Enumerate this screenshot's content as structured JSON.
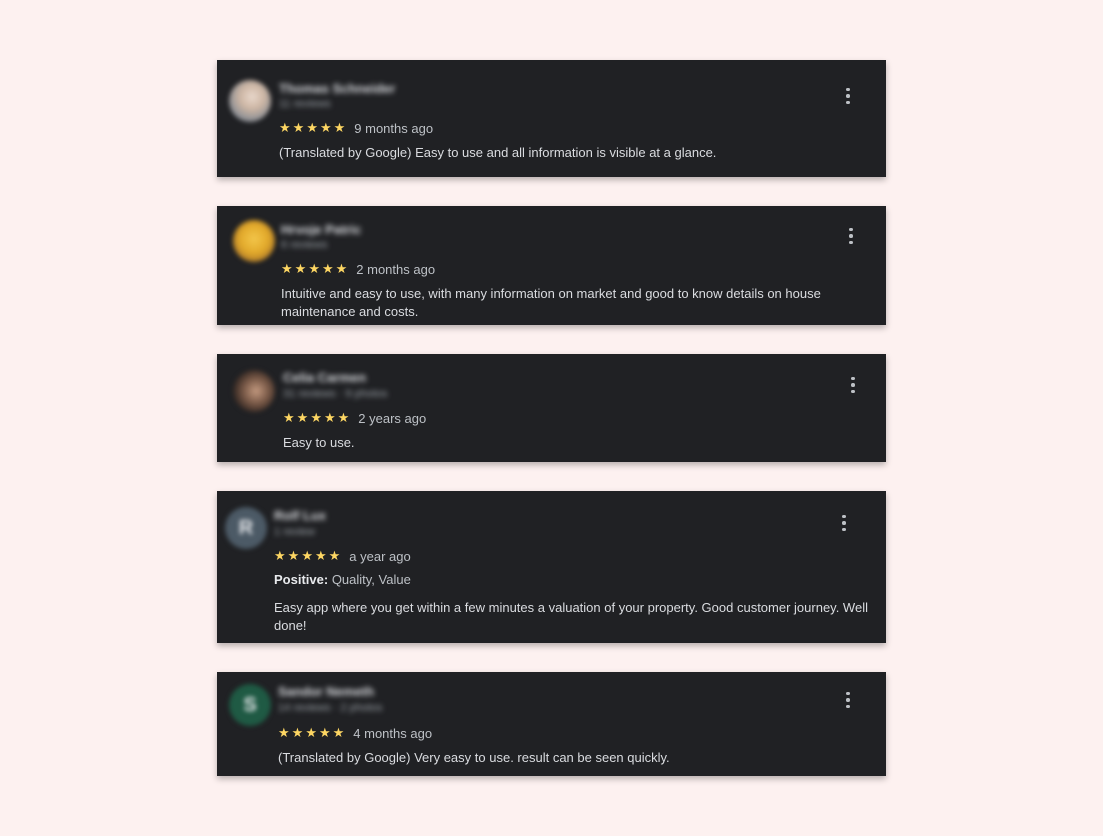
{
  "reviews": [
    {
      "reviewer_name": "Thomas Schneider",
      "reviewer_meta": "11 reviews",
      "stars": "★★★★★",
      "rating": 5,
      "date": "9 months ago",
      "text": "(Translated by Google) Easy to use and all information is visible at a glance."
    },
    {
      "reviewer_name": "Hrvoje Patric",
      "reviewer_meta": "6 reviews",
      "stars": "★★★★★",
      "rating": 5,
      "date": "2 months ago",
      "text": "Intuitive and easy to use, with many information on market and good to know details on house maintenance and costs."
    },
    {
      "reviewer_name": "Celia Carmen",
      "reviewer_meta": "31 reviews · 9 photos",
      "stars": "★★★★★",
      "rating": 5,
      "date": "2 years ago",
      "text": "Easy to use."
    },
    {
      "reviewer_name": "Rolf Lux",
      "reviewer_meta": "1 review",
      "avatar_initial": "R",
      "stars": "★★★★★",
      "rating": 5,
      "date": "a year ago",
      "attributes_label": "Positive:",
      "attributes_value": "Quality, Value",
      "text": "Easy app where you get within a few minutes a valuation of your property. Good customer journey. Well done!"
    },
    {
      "reviewer_name": "Sandor Nemeth",
      "reviewer_meta": "14 reviews · 2 photos",
      "avatar_initial": "S",
      "stars": "★★★★★",
      "rating": 5,
      "date": "4 months ago",
      "text": "(Translated by Google) Very easy to use. result can be seen quickly."
    }
  ],
  "colors": {
    "page_background": "#fdf1f0",
    "card_background": "#202124",
    "star": "#fdd663"
  },
  "icons": {
    "more_options": "more-vert-icon",
    "star": "star-icon"
  }
}
